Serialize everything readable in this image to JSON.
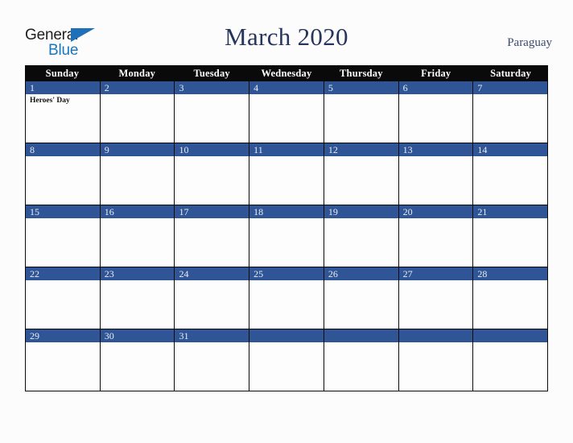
{
  "brand": {
    "word_one": "General",
    "word_two": "Blue",
    "triangle_color": "#1e71b8",
    "word_one_color": "#20201f",
    "word_two_color": "#1878be"
  },
  "header": {
    "title": "March 2020",
    "title_color": "#26355c",
    "country": "Paraguay",
    "country_color": "#3c4a6b"
  },
  "calendar": {
    "weekday_header_bg": "#0a0a0a",
    "weekday_header_color": "#ffffff",
    "date_bar_bg": "#2f5597",
    "date_bar_color": "#e9edf5",
    "grid_line_color": "#0a0a0a",
    "cell_bg": "#fdfdfd",
    "weekdays": [
      "Sunday",
      "Monday",
      "Tuesday",
      "Wednesday",
      "Thursday",
      "Friday",
      "Saturday"
    ],
    "weeks": [
      [
        {
          "day": "1",
          "events": [
            "Heroes' Day"
          ]
        },
        {
          "day": "2",
          "events": []
        },
        {
          "day": "3",
          "events": []
        },
        {
          "day": "4",
          "events": []
        },
        {
          "day": "5",
          "events": []
        },
        {
          "day": "6",
          "events": []
        },
        {
          "day": "7",
          "events": []
        }
      ],
      [
        {
          "day": "8",
          "events": []
        },
        {
          "day": "9",
          "events": []
        },
        {
          "day": "10",
          "events": []
        },
        {
          "day": "11",
          "events": []
        },
        {
          "day": "12",
          "events": []
        },
        {
          "day": "13",
          "events": []
        },
        {
          "day": "14",
          "events": []
        }
      ],
      [
        {
          "day": "15",
          "events": []
        },
        {
          "day": "16",
          "events": []
        },
        {
          "day": "17",
          "events": []
        },
        {
          "day": "18",
          "events": []
        },
        {
          "day": "19",
          "events": []
        },
        {
          "day": "20",
          "events": []
        },
        {
          "day": "21",
          "events": []
        }
      ],
      [
        {
          "day": "22",
          "events": []
        },
        {
          "day": "23",
          "events": []
        },
        {
          "day": "24",
          "events": []
        },
        {
          "day": "25",
          "events": []
        },
        {
          "day": "26",
          "events": []
        },
        {
          "day": "27",
          "events": []
        },
        {
          "day": "28",
          "events": []
        }
      ],
      [
        {
          "day": "29",
          "events": []
        },
        {
          "day": "30",
          "events": []
        },
        {
          "day": "31",
          "events": []
        },
        {
          "day": "",
          "events": []
        },
        {
          "day": "",
          "events": []
        },
        {
          "day": "",
          "events": []
        },
        {
          "day": "",
          "events": []
        }
      ]
    ]
  }
}
